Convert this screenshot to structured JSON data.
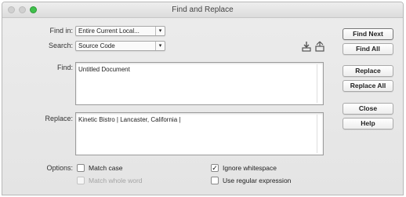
{
  "window": {
    "title": "Find and Replace"
  },
  "find_in": {
    "label": "Find in:",
    "value": "Entire Current Local..."
  },
  "search": {
    "label": "Search:",
    "value": "Source Code"
  },
  "find": {
    "label": "Find:",
    "value": "Untitled Document"
  },
  "replace": {
    "label": "Replace:",
    "value": "Kinetic Bistro | Lancaster, California |"
  },
  "buttons": {
    "find_next": "Find Next",
    "find_all": "Find All",
    "replace": "Replace",
    "replace_all": "Replace All",
    "close": "Close",
    "help": "Help"
  },
  "options": {
    "label": "Options:",
    "match_case": {
      "label": "Match case",
      "checked": false
    },
    "match_whole_word": {
      "label": "Match whole word",
      "checked": false,
      "disabled": true
    },
    "ignore_whitespace": {
      "label": "Ignore whitespace",
      "checked": true
    },
    "use_regex": {
      "label": "Use regular expression",
      "checked": false
    }
  },
  "icons": {
    "load_query": "download-icon",
    "save_query": "save-icon"
  }
}
